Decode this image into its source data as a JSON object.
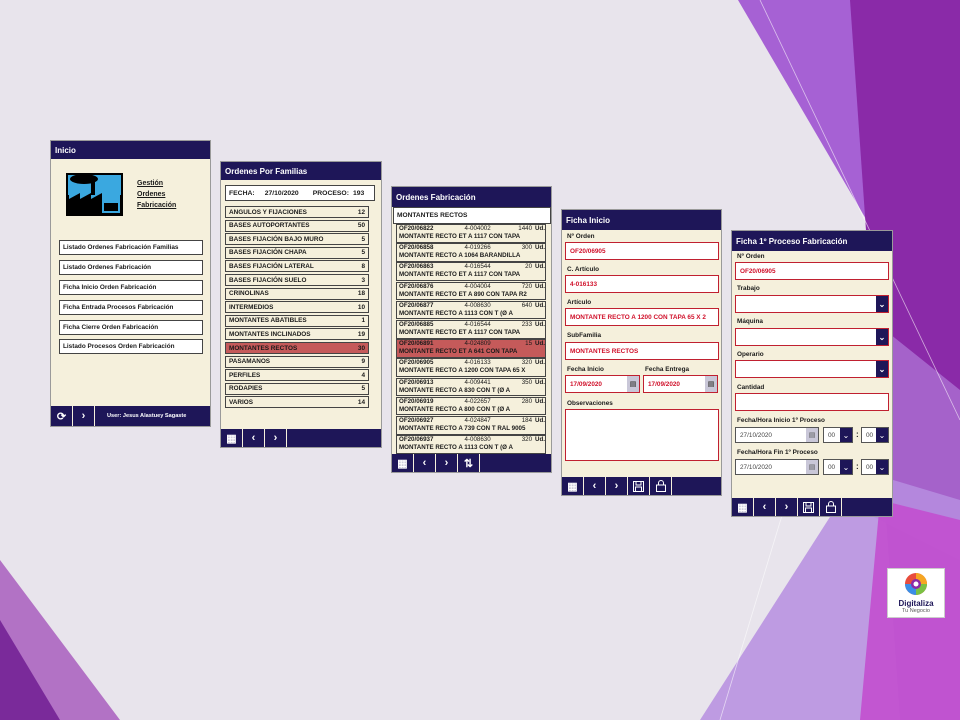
{
  "colors": {
    "header": "#1e1658",
    "panel": "#f5f0dc",
    "selected": "#c55a5a",
    "value": "#d0102a",
    "accent_purple": "#8a2aa8"
  },
  "inicio": {
    "title": "Inicio",
    "app_name_lines": [
      "Gestión",
      "Ordenes",
      "Fabricación"
    ],
    "menu": [
      "Listado Ordenes Fabricación Familias",
      "Listado Ordenes Fabricación",
      "Ficha Inicio Orden Fabricación",
      "Ficha Entrada Procesos Fabricación",
      "Ficha Cierre Orden Fabricación",
      "Listado Procesos Orden Fabricación"
    ],
    "user": "User:  Jesus Alastuey Sagaste",
    "icons": [
      "refresh-icon",
      "chevron-right-icon"
    ]
  },
  "familias": {
    "title": "Ordenes Por Familias",
    "fecha_label": "FECHA:",
    "fecha": "27/10/2020",
    "proceso_label": "PROCESO:",
    "proceso": "193",
    "selected_index": 10,
    "rows": [
      {
        "name": "ANGULOS Y FIJACIONES",
        "count": "12"
      },
      {
        "name": "BASES AUTOPORTANTES",
        "count": "50"
      },
      {
        "name": "BASES FIJACIÓN BAJO MURO",
        "count": "5"
      },
      {
        "name": "BASES FIJACIÓN CHAPA",
        "count": "5"
      },
      {
        "name": "BASES FIJACIÓN LATERAL",
        "count": "8"
      },
      {
        "name": "BASES FIJACIÓN SUELO",
        "count": "3"
      },
      {
        "name": "CRINOLINAS",
        "count": "18"
      },
      {
        "name": "INTERMEDIOS",
        "count": "10"
      },
      {
        "name": "MONTANTES ABATIBLES",
        "count": "1"
      },
      {
        "name": "MONTANTES INCLINADOS",
        "count": "19"
      },
      {
        "name": "MONTANTES RECTOS",
        "count": "30"
      },
      {
        "name": "PASAMANOS",
        "count": "9"
      },
      {
        "name": "PERFILES",
        "count": "4"
      },
      {
        "name": "RODAPIES",
        "count": "5"
      },
      {
        "name": "VARIOS",
        "count": "14"
      }
    ],
    "icons": [
      "grid-icon",
      "chevron-left-icon",
      "chevron-right-icon"
    ]
  },
  "ordenes": {
    "title": "Ordenes Fabricación",
    "family": "MONTANTES RECTOS",
    "selected_index": 6,
    "rows": [
      {
        "of": "OF20/06822",
        "code": "4-004002",
        "qty": "1440",
        "unit": "Ud.",
        "desc": "MONTANTE RECTO ET A 1117 CON TAPA"
      },
      {
        "of": "OF20/06858",
        "code": "4-019266",
        "qty": "300",
        "unit": "Ud.",
        "desc": "MONTANTE RECTO A 1064 BARANDILLA"
      },
      {
        "of": "OF20/06863",
        "code": "4-016544",
        "qty": "20",
        "unit": "Ud.",
        "desc": "MONTANTE RECTO ET A 1117 CON TAPA"
      },
      {
        "of": "OF20/06876",
        "code": "4-004004",
        "qty": "720",
        "unit": "Ud.",
        "desc": "MONTANTE RECTO ET A 890 CON TAPA R2"
      },
      {
        "of": "OF20/06877",
        "code": "4-008630",
        "qty": "640",
        "unit": "Ud.",
        "desc": "MONTANTE RECTO A 1113 CON T (Ø A"
      },
      {
        "of": "OF20/06885",
        "code": "4-016544",
        "qty": "233",
        "unit": "Ud.",
        "desc": "MONTANTE RECTO ET A 1117 CON TAPA"
      },
      {
        "of": "OF20/06891",
        "code": "4-024809",
        "qty": "15",
        "unit": "Ud.",
        "desc": "MONTANTE RECTO ET A 641 CON TAPA"
      },
      {
        "of": "OF20/06905",
        "code": "4-016133",
        "qty": "320",
        "unit": "Ud.",
        "desc": "MONTANTE RECTO A 1200 CON TAPA 65 X"
      },
      {
        "of": "OF20/06913",
        "code": "4-009441",
        "qty": "350",
        "unit": "Ud.",
        "desc": "MONTANTE RECTO A 830 CON T (Ø A"
      },
      {
        "of": "OF20/06919",
        "code": "4-022657",
        "qty": "280",
        "unit": "Ud.",
        "desc": "MONTANTE RECTO A 800 CON T (Ø A"
      },
      {
        "of": "OF20/06927",
        "code": "4-024847",
        "qty": "184",
        "unit": "Ud.",
        "desc": "MONTANTE RECTO A 739 CON T RAL 9005"
      },
      {
        "of": "OF20/06937",
        "code": "4-008630",
        "qty": "320",
        "unit": "Ud.",
        "desc": "MONTANTE RECTO A 1113 CON T (Ø A"
      }
    ],
    "icons": [
      "grid-icon",
      "chevron-left-icon",
      "chevron-right-icon",
      "sort-icon"
    ]
  },
  "ficha_inicio": {
    "title": "Ficha Inicio",
    "orden_label": "Nº Orden",
    "orden": "OF20/06905",
    "articulo_label": "C. Artículo",
    "articulo": "4-016133",
    "art_desc_label": "Artículo",
    "art_desc": "MONTANTE RECTO A 1200 CON TAPA 65 X 2",
    "subfamilia_label": "SubFamilia",
    "subfamilia": "MONTANTES RECTOS",
    "fecha_inicio_label": "Fecha Inicio",
    "fecha_inicio": "17/09/2020",
    "fecha_entrega_label": "Fecha Entrega",
    "fecha_entrega": "17/09/2020",
    "obs_label": "Observaciones",
    "obs": "",
    "icons": [
      "grid-icon",
      "chevron-left-icon",
      "chevron-right-icon",
      "save-icon",
      "lock-icon"
    ]
  },
  "ficha_proceso": {
    "title": "Ficha 1º Proceso Fabricación",
    "orden_label": "Nº Orden",
    "orden": "OF20/06905",
    "trabajo_label": "Trabajo",
    "trabajo": "",
    "maquina_label": "Máquina",
    "maquina": "",
    "operario_label": "Operario",
    "operario": "",
    "cantidad_label": "Cantidad",
    "cantidad": "",
    "inicio_label": "Fecha/Hora Inicio 1º Proceso",
    "inicio_fecha": "27/10/2020",
    "inicio_h": "00",
    "inicio_m": "00",
    "fin_label": "Fecha/Hora Fin 1º Proceso",
    "fin_fecha": "27/10/2020",
    "fin_h": "00",
    "fin_m": "00",
    "sep": ":",
    "icons": [
      "grid-icon",
      "chevron-left-icon",
      "chevron-right-icon",
      "save-icon",
      "lock-icon"
    ]
  },
  "logo": {
    "line1": "Digitaliza",
    "line2": "Tu Negocio"
  }
}
